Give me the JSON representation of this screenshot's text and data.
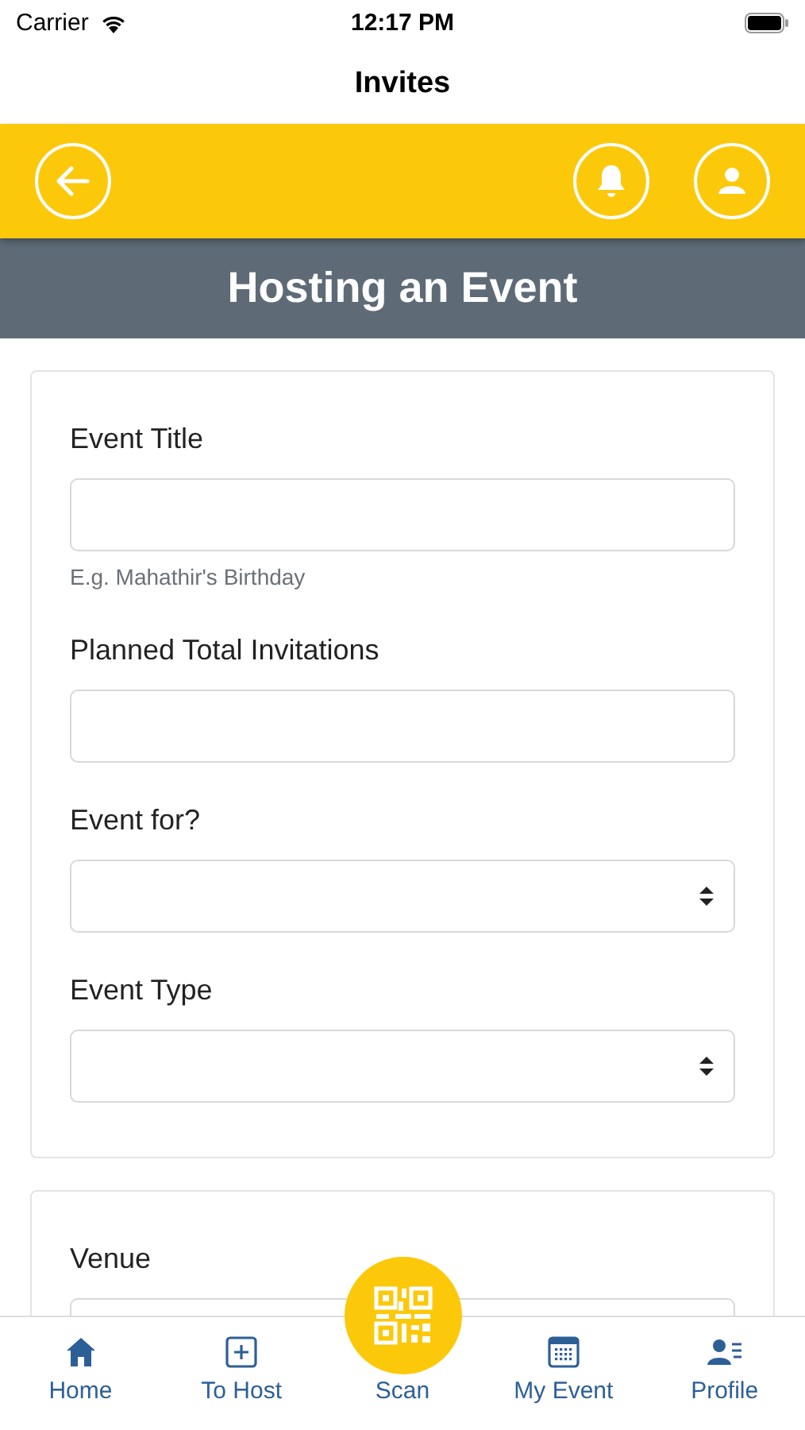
{
  "status_bar": {
    "carrier": "Carrier",
    "time": "12:17 PM"
  },
  "nav_bar": {
    "title": "Invites"
  },
  "header": {
    "title": "Hosting an Event"
  },
  "cards": [
    {
      "fields": [
        {
          "label": "Event Title",
          "kind": "text",
          "hint": "E.g. Mahathir's Birthday"
        },
        {
          "label": "Planned Total Invitations",
          "kind": "text"
        },
        {
          "label": "Event for?",
          "kind": "select"
        },
        {
          "label": "Event Type",
          "kind": "select"
        }
      ]
    },
    {
      "fields": [
        {
          "label": "Venue",
          "kind": "text"
        }
      ]
    }
  ],
  "tab_bar": [
    {
      "label": "Home",
      "kind": "home",
      "selected": false
    },
    {
      "label": "To Host",
      "kind": "add",
      "selected": false
    },
    {
      "label": "Scan",
      "kind": "scan",
      "selected": false
    },
    {
      "label": "My Event",
      "kind": "calendar",
      "selected": false
    },
    {
      "label": "Profile",
      "kind": "profile",
      "selected": false
    }
  ]
}
